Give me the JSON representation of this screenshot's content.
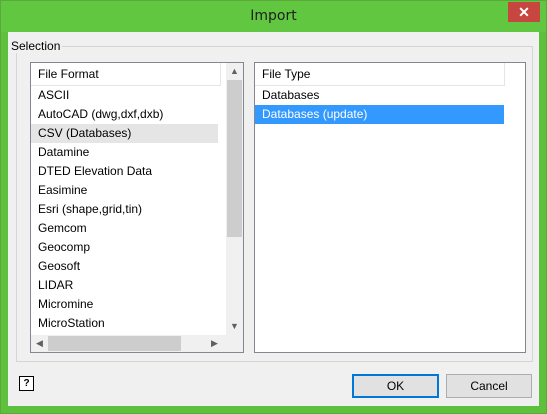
{
  "window": {
    "title": "Import",
    "close_glyph": "✕"
  },
  "selection": {
    "label": "Selection",
    "file_format": {
      "header": "File Format",
      "items": [
        "ASCII",
        "AutoCAD (dwg,dxf,dxb)",
        "CSV (Databases)",
        "Datamine",
        "DTED Elevation Data",
        "Easimine",
        "Esri (shape,grid,tin)",
        "Gemcom",
        "Geocomp",
        "Geosoft",
        "LIDAR",
        "Micromine",
        "MicroStation"
      ],
      "selected": "CSV (Databases)"
    },
    "file_type": {
      "header": "File Type",
      "items": [
        "Databases",
        "Databases (update)"
      ],
      "selected": "Databases (update)"
    }
  },
  "buttons": {
    "ok": "OK",
    "cancel": "Cancel"
  },
  "help": {
    "glyph": "?"
  },
  "colors": {
    "titlebar": "#62c740",
    "selection_blue": "#3399ff",
    "close_red": "#c7463f"
  }
}
